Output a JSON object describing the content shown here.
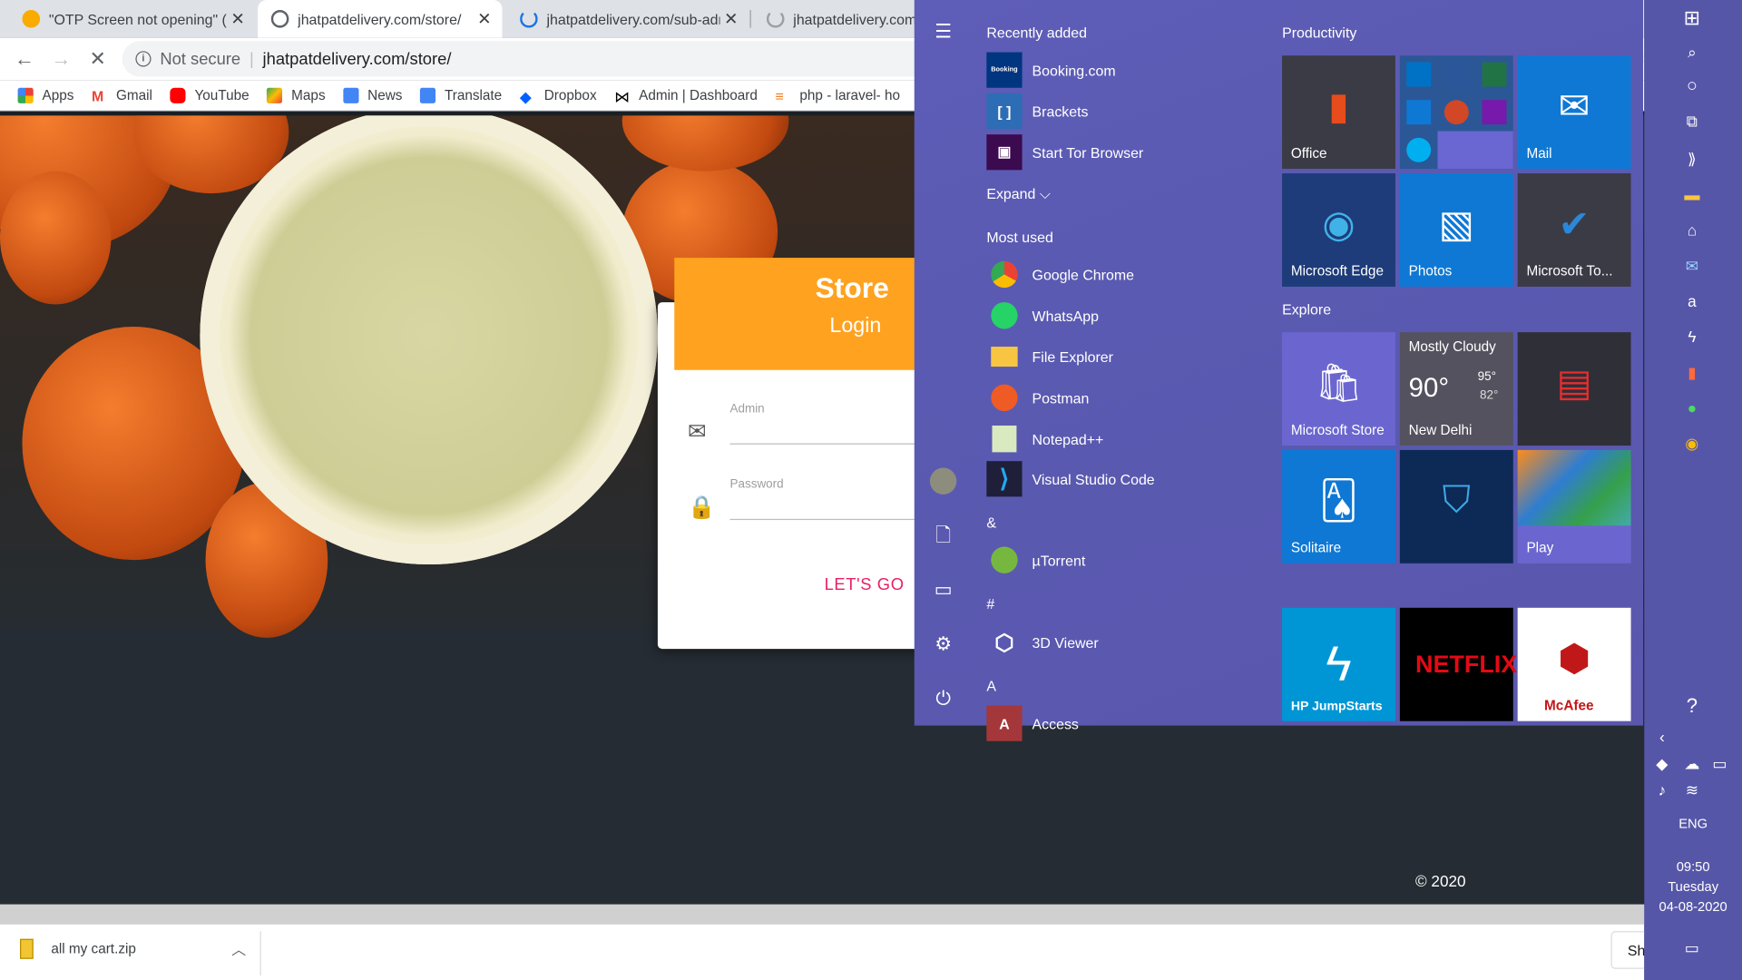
{
  "browser": {
    "tabs": [
      {
        "title": "\"OTP Screen not opening\" (#",
        "close": "✕"
      },
      {
        "title": "jhatpatdelivery.com/store/",
        "close": "✕"
      },
      {
        "title": "jhatpatdelivery.com/sub-adm",
        "close": "✕"
      },
      {
        "title": "jhatpatdelivery.com",
        "close": ""
      }
    ],
    "omnibox": {
      "security": "Not secure",
      "url": "jhatpatdelivery.com/store/"
    },
    "bookmarks": [
      "Apps",
      "Gmail",
      "YouTube",
      "Maps",
      "News",
      "Translate",
      "Dropbox",
      "Admin | Dashboard",
      "php - laravel- ho"
    ]
  },
  "page": {
    "card": {
      "title": "Store",
      "subtitle": "Login",
      "admin_label": "Admin",
      "password_label": "Password",
      "submit": "LET'S GO"
    },
    "footer": "© 2020"
  },
  "downloads": {
    "file": "all my cart.zip",
    "show_all": "Sh"
  },
  "start_menu": {
    "recently_added_header": "Recently added",
    "recently_added": [
      "Booking.com",
      "Brackets",
      "Start Tor Browser"
    ],
    "expand": "Expand",
    "most_used_header": "Most used",
    "most_used": [
      "Google Chrome",
      "WhatsApp",
      "File Explorer",
      "Postman",
      "Notepad++",
      "Visual Studio Code"
    ],
    "letter_amp": "&",
    "amp_apps": [
      "µTorrent"
    ],
    "letter_hash": "#",
    "hash_apps": [
      "3D Viewer"
    ],
    "letter_a": "A",
    "a_apps": [
      "Access"
    ],
    "productivity_header": "Productivity",
    "explore_header": "Explore",
    "tiles": {
      "office": "Office",
      "mail": "Mail",
      "edge": "Microsoft Edge",
      "photos": "Photos",
      "todo": "Microsoft To...",
      "store": "Microsoft Store",
      "solitaire": "Solitaire",
      "play": "Play",
      "hp": "HP JumpStarts",
      "netflix": "NETFLIX",
      "mcafee": "McAfee"
    },
    "weather": {
      "condition": "Mostly Cloudy",
      "temp": "90°",
      "high": "95°",
      "low": "82°",
      "city": "New Delhi"
    }
  },
  "taskbar": {
    "language": "ENG",
    "time": "09:50",
    "day": "Tuesday",
    "date": "04-08-2020"
  },
  "colors": {
    "accent_orange": "#ffa21f",
    "start_bg": "#5b5ab1",
    "link_pink": "#e91e63"
  }
}
